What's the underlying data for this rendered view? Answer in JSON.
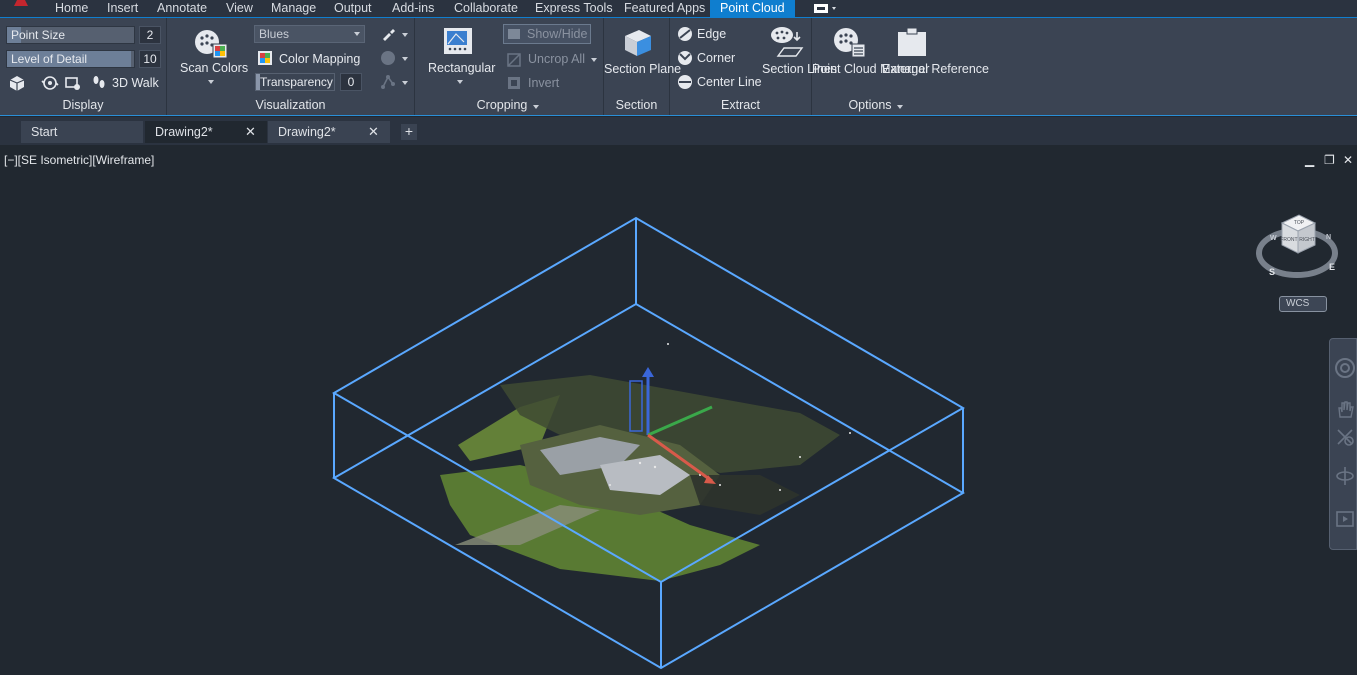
{
  "menu": {
    "tabs": [
      "Home",
      "Insert",
      "Annotate",
      "View",
      "Manage",
      "Output",
      "Add-ins",
      "Collaborate",
      "Express Tools",
      "Featured Apps",
      "Point Cloud"
    ],
    "active": "Point Cloud"
  },
  "ribbon": {
    "display": {
      "title": "Display",
      "point_size_label": "Point Size",
      "point_size_value": "2",
      "level_of_detail_label": "Level of Detail",
      "level_of_detail_value": "10",
      "walk_label": "3D Walk"
    },
    "visualization": {
      "title": "Visualization",
      "scan_colors_label": "Scan Colors",
      "color_scheme": "Blues",
      "color_mapping_label": "Color Mapping",
      "transparency_label": "Transparency",
      "transparency_value": "0"
    },
    "cropping": {
      "title": "Cropping",
      "rectangular_label": "Rectangular",
      "show_hide_label": "Show/Hide",
      "uncrop_all_label": "Uncrop All",
      "invert_label": "Invert"
    },
    "section": {
      "title": "Section",
      "section_plane_label": "Section Plane"
    },
    "extract": {
      "title": "Extract",
      "edge_label": "Edge",
      "corner_label": "Corner",
      "center_line_label": "Center Line",
      "section_lines_label": "Section Lines"
    },
    "options": {
      "title": "Options",
      "point_cloud_manager_label": "Point Cloud Manager",
      "external_reference_label": "External Reference"
    }
  },
  "file_tabs": [
    {
      "label": "Start"
    },
    {
      "label": "Drawing2*"
    },
    {
      "label": "Drawing2*"
    }
  ],
  "viewport": {
    "label": "[−][SE Isometric][Wireframe]",
    "wcs_label": "WCS",
    "viewcube": {
      "top": "TOP",
      "front": "FRONT",
      "right": "RIGHT",
      "s": "S",
      "e": "E",
      "w": "W",
      "n": "N"
    }
  },
  "colors": {
    "accent": "#0f7ecf",
    "ribbon_bg": "#3b4453",
    "viewport_bg": "#212830",
    "crop_box": "#5aa8ff"
  }
}
